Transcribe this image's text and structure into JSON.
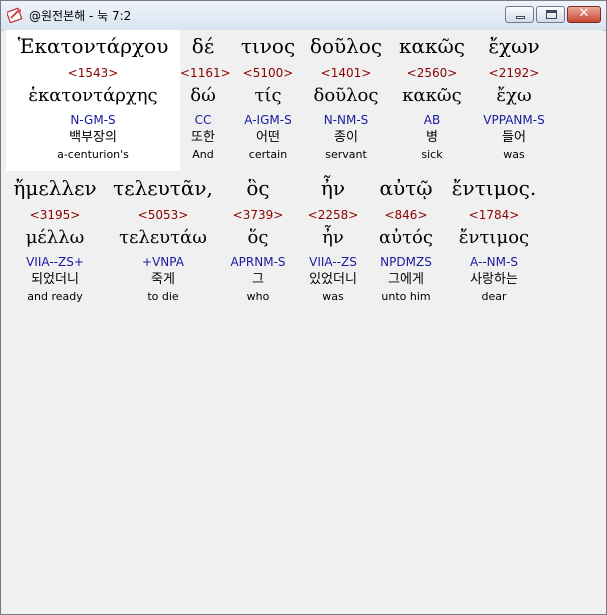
{
  "window": {
    "title": "@원전본해 - 눅 7:2"
  },
  "rows": [
    {
      "words": [
        {
          "greek": "Ἑκατοντάρχου",
          "strong": "<1543>",
          "lemma": "ἑκατοντάρχης",
          "parse": "N-GM-S",
          "korean": "백부장의",
          "english": "a-centurion's"
        },
        {
          "greek": "δέ",
          "strong": "<1161>",
          "lemma": "δώ",
          "parse": "CC",
          "korean": "또한",
          "english": "And"
        },
        {
          "greek": "τινος",
          "strong": "<5100>",
          "lemma": "τίς",
          "parse": "A-IGM-S",
          "korean": "어떤",
          "english": "certain"
        },
        {
          "greek": "δοῦλος",
          "strong": "<1401>",
          "lemma": "δοῦλος",
          "parse": "N-NM-S",
          "korean": "종이",
          "english": "servant"
        },
        {
          "greek": "κακῶς",
          "strong": "<2560>",
          "lemma": "κακῶς",
          "parse": "AB",
          "korean": "병",
          "english": "sick"
        },
        {
          "greek": "ἔχων",
          "strong": "<2192>",
          "lemma": "ἔχω",
          "parse": "VPPANM-S",
          "korean": "들어",
          "english": "was"
        }
      ]
    },
    {
      "words": [
        {
          "greek": "ἤμελλεν",
          "strong": "<3195>",
          "lemma": "μέλλω",
          "parse": "VIIA--ZS+",
          "korean": "되었더니",
          "english": "and ready"
        },
        {
          "greek": "τελευτᾶν,",
          "strong": "<5053>",
          "lemma": "τελευτάω",
          "parse": "+VNPA",
          "korean": "죽게",
          "english": "to die"
        },
        {
          "greek": "ὃς",
          "strong": "<3739>",
          "lemma": "ὅς",
          "parse": "APRNM-S",
          "korean": "그",
          "english": "who"
        },
        {
          "greek": "ἦν",
          "strong": "<2258>",
          "lemma": "ἦν",
          "parse": "VIIA--ZS",
          "korean": "있었더니",
          "english": "was"
        },
        {
          "greek": "αὐτῷ",
          "strong": "<846>",
          "lemma": "αὐτός",
          "parse": "NPDMZS",
          "korean": "그에게",
          "english": "unto him"
        },
        {
          "greek": "ἔντιμος.",
          "strong": "<1784>",
          "lemma": "ἔντιμος",
          "parse": "A--NM-S",
          "korean": "사랑하는",
          "english": "dear"
        }
      ]
    }
  ]
}
